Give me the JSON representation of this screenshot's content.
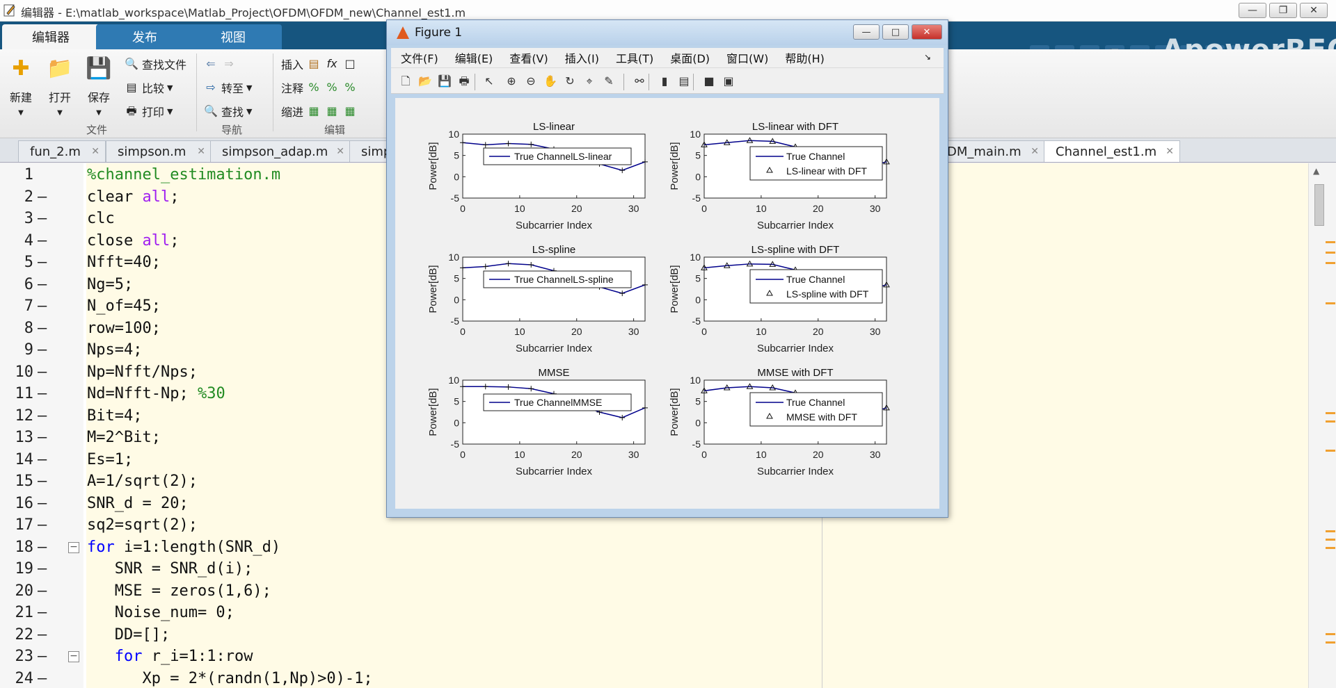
{
  "window": {
    "title": "编辑器 - E:\\matlab_workspace\\Matlab_Project\\OFDM\\OFDM_new\\Channel_est1.m"
  },
  "ribbon": {
    "tabs": [
      "编辑器",
      "发布",
      "视图"
    ],
    "watermark": "ApowerREC",
    "file_group": {
      "label": "文件",
      "new": "新建",
      "open": "打开",
      "save": "保存",
      "find_files": "查找文件",
      "compare": "比较",
      "print": "打印"
    },
    "nav_group": {
      "label": "导航",
      "goto": "转至",
      "find": "查找"
    },
    "edit_group": {
      "label": "编辑",
      "insert": "插入",
      "comment": "注释",
      "indent": "缩进",
      "fx": "fx"
    }
  },
  "file_tabs": [
    "fun_2.m",
    "simpson.m",
    "simpson_adap.m",
    "simp",
    "DM_main.m",
    "Channel_est1.m"
  ],
  "active_file_tab": "Channel_est1.m",
  "editor": {
    "lines": [
      {
        "n": "1",
        "dash": false,
        "code": "%channel_estimation.m"
      },
      {
        "n": "2",
        "dash": true,
        "code": "clear all;"
      },
      {
        "n": "3",
        "dash": true,
        "code": "clc"
      },
      {
        "n": "4",
        "dash": true,
        "code": "close all;"
      },
      {
        "n": "5",
        "dash": true,
        "code": "Nfft=40;"
      },
      {
        "n": "6",
        "dash": true,
        "code": "Ng=5;"
      },
      {
        "n": "7",
        "dash": true,
        "code": "N_of=45;"
      },
      {
        "n": "8",
        "dash": true,
        "code": "row=100;"
      },
      {
        "n": "9",
        "dash": true,
        "code": "Nps=4;"
      },
      {
        "n": "10",
        "dash": true,
        "code": "Np=Nfft/Nps;"
      },
      {
        "n": "11",
        "dash": true,
        "code": "Nd=Nfft-Np; %30"
      },
      {
        "n": "12",
        "dash": true,
        "code": "Bit=4;"
      },
      {
        "n": "13",
        "dash": true,
        "code": "M=2^Bit;"
      },
      {
        "n": "14",
        "dash": true,
        "code": "Es=1;"
      },
      {
        "n": "15",
        "dash": true,
        "code": "A=1/sqrt(2);"
      },
      {
        "n": "16",
        "dash": true,
        "code": "SNR_d = 20;"
      },
      {
        "n": "17",
        "dash": true,
        "code": "sq2=sqrt(2);"
      },
      {
        "n": "18",
        "dash": true,
        "code": "for i=1:length(SNR_d)"
      },
      {
        "n": "19",
        "dash": true,
        "code": "   SNR = SNR_d(i);"
      },
      {
        "n": "20",
        "dash": true,
        "code": "   MSE = zeros(1,6);"
      },
      {
        "n": "21",
        "dash": true,
        "code": "   Noise_num= 0;"
      },
      {
        "n": "22",
        "dash": true,
        "code": "   DD=[];"
      },
      {
        "n": "23",
        "dash": true,
        "code": "   for r_i=1:1:row"
      },
      {
        "n": "24",
        "dash": true,
        "code": "      Xp = 2*(randn(1,Np)>0)-1;"
      }
    ]
  },
  "figure": {
    "title": "Figure 1",
    "menu": [
      "文件(F)",
      "编辑(E)",
      "查看(V)",
      "插入(I)",
      "工具(T)",
      "桌面(D)",
      "窗口(W)",
      "帮助(H)"
    ],
    "toolbar_icons": [
      "new-figure-icon",
      "open-icon",
      "save-icon",
      "print-icon",
      "pointer-icon",
      "zoom-in-icon",
      "zoom-out-icon",
      "pan-icon",
      "rotate-icon",
      "data-cursor-icon",
      "brush-icon",
      "link-icon",
      "colorbar-icon",
      "legend-icon",
      "hide-tools-icon",
      "show-tools-icon"
    ]
  },
  "chart_data": [
    {
      "type": "line",
      "title": "LS-linear",
      "xlabel": "Subcarrier Index",
      "ylabel": "Power[dB]",
      "xlim": [
        0,
        32
      ],
      "ylim": [
        -5,
        10
      ],
      "xticks": [
        0,
        10,
        20,
        30
      ],
      "yticks": [
        10,
        5,
        0,
        -5
      ],
      "legend": [
        "True ChannelLS-linear"
      ],
      "legend_position": "inside",
      "marker": "+",
      "series": [
        {
          "name": "True Channel",
          "x": [
            0,
            4,
            8,
            12,
            16,
            20,
            24,
            28,
            32
          ],
          "y": [
            8,
            7.5,
            7.8,
            7.6,
            6.5,
            5,
            3,
            1.5,
            3.5
          ]
        }
      ]
    },
    {
      "type": "line",
      "title": "LS-linear with DFT",
      "xlabel": "Subcarrier Index",
      "ylabel": "Power[dB]",
      "xlim": [
        0,
        32
      ],
      "ylim": [
        -5,
        10
      ],
      "xticks": [
        0,
        10,
        20,
        30
      ],
      "yticks": [
        10,
        5,
        0,
        -5
      ],
      "legend": [
        "True Channel",
        "LS-linear with DFT"
      ],
      "marker": "triangle",
      "series": [
        {
          "name": "True Channel",
          "x": [
            0,
            4,
            8,
            12,
            16,
            20,
            24,
            28,
            32
          ],
          "y": [
            7.5,
            8,
            8.5,
            8.3,
            7,
            5,
            3,
            2,
            3.5
          ]
        }
      ]
    },
    {
      "type": "line",
      "title": "LS-spline",
      "xlabel": "Subcarrier Index",
      "ylabel": "Power[dB]",
      "xlim": [
        0,
        32
      ],
      "ylim": [
        -5,
        10
      ],
      "xticks": [
        0,
        10,
        20,
        30
      ],
      "yticks": [
        10,
        5,
        0,
        -5
      ],
      "legend": [
        "True ChannelLS-spline"
      ],
      "marker": "+",
      "series": [
        {
          "name": "True Channel",
          "x": [
            0,
            4,
            8,
            12,
            16,
            20,
            24,
            28,
            32
          ],
          "y": [
            7.5,
            7.8,
            8.5,
            8.2,
            6.8,
            4.8,
            3,
            1.5,
            3.5
          ]
        }
      ]
    },
    {
      "type": "line",
      "title": "LS-spline with DFT",
      "xlabel": "Subcarrier Index",
      "ylabel": "Power[dB]",
      "xlim": [
        0,
        32
      ],
      "ylim": [
        -5,
        10
      ],
      "xticks": [
        0,
        10,
        20,
        30
      ],
      "yticks": [
        10,
        5,
        0,
        -5
      ],
      "legend": [
        "True Channel",
        "LS-spline with DFT"
      ],
      "marker": "triangle",
      "series": [
        {
          "name": "True Channel",
          "x": [
            0,
            4,
            8,
            12,
            16,
            20,
            24,
            28,
            32
          ],
          "y": [
            7.5,
            8,
            8.4,
            8.3,
            7,
            5,
            3,
            2,
            3.5
          ]
        }
      ]
    },
    {
      "type": "line",
      "title": "MMSE",
      "xlabel": "Subcarrier Index",
      "ylabel": "Power[dB]",
      "xlim": [
        0,
        32
      ],
      "ylim": [
        -5,
        10
      ],
      "xticks": [
        0,
        10,
        20,
        30
      ],
      "yticks": [
        10,
        5,
        0,
        -5
      ],
      "legend": [
        "True ChannelMMSE"
      ],
      "marker": "+",
      "series": [
        {
          "name": "True Channel",
          "x": [
            0,
            4,
            8,
            12,
            16,
            20,
            24,
            28,
            32
          ],
          "y": [
            8.5,
            8.5,
            8.4,
            8,
            6.8,
            4.5,
            2.5,
            1.2,
            3.5
          ]
        }
      ]
    },
    {
      "type": "line",
      "title": "MMSE with DFT",
      "xlabel": "Subcarrier Index",
      "ylabel": "Power[dB]",
      "xlim": [
        0,
        32
      ],
      "ylim": [
        -5,
        10
      ],
      "xticks": [
        0,
        10,
        20,
        30
      ],
      "yticks": [
        10,
        5,
        0,
        -5
      ],
      "legend": [
        "True Channel",
        "MMSE with DFT"
      ],
      "marker": "triangle",
      "series": [
        {
          "name": "True Channel",
          "x": [
            0,
            4,
            8,
            12,
            16,
            20,
            24,
            28,
            32
          ],
          "y": [
            7.5,
            8.2,
            8.5,
            8.2,
            7,
            5,
            3,
            1.8,
            3.5
          ]
        }
      ]
    }
  ],
  "colors": {
    "ribbon_tab_bg": "#16557f",
    "line_color": "#00008b",
    "comment": "#228b22",
    "keyword": "#0000ff",
    "string": "#a020f0"
  }
}
